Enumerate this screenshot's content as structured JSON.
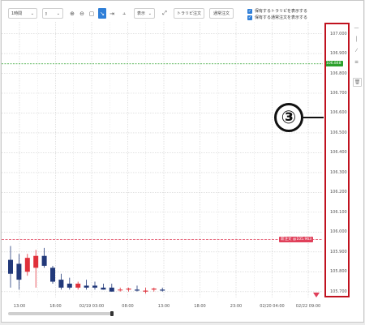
{
  "toolbar": {
    "timeframe": "1時間",
    "chart_type_icon": "candlestick-icon",
    "display_label": "表示",
    "trailing_order_button": "トラリピ注文",
    "normal_order_button": "通常注文",
    "check_trailing": "保有するトラリピを表示する",
    "check_normal": "保有する通常注文を表示する"
  },
  "chart_data": {
    "type": "candlestick",
    "price_labels": [
      "107.000",
      "106.900",
      "106.800",
      "106.700",
      "106.600",
      "106.500",
      "106.400",
      "106.300",
      "106.200",
      "106.100",
      "106.000",
      "105.900",
      "105.800",
      "105.700"
    ],
    "time_labels": [
      "13:00",
      "18:00",
      "02/19 03:00",
      "08:00",
      "13:00",
      "18:00",
      "23:00",
      "02/20 04:00",
      "02/22 09:00"
    ],
    "current_price": "106.848",
    "order_line_label": "新注文 @105.963",
    "current_price_color": "#2aa02a",
    "order_line_color": "#e0405a",
    "up_color": "#e0303a",
    "down_color": "#22397a",
    "ylim": [
      105.695,
      107.035
    ],
    "candles": [
      {
        "o": 105.86,
        "h": 105.93,
        "l": 105.72,
        "c": 105.79
      },
      {
        "o": 105.84,
        "h": 105.89,
        "l": 105.71,
        "c": 105.76
      },
      {
        "o": 105.8,
        "h": 105.89,
        "l": 105.78,
        "c": 105.87
      },
      {
        "o": 105.82,
        "h": 105.91,
        "l": 105.72,
        "c": 105.88
      },
      {
        "o": 105.88,
        "h": 105.92,
        "l": 105.82,
        "c": 105.83
      },
      {
        "o": 105.82,
        "h": 105.83,
        "l": 105.74,
        "c": 105.75
      },
      {
        "o": 105.76,
        "h": 105.79,
        "l": 105.71,
        "c": 105.72
      },
      {
        "o": 105.74,
        "h": 105.77,
        "l": 105.71,
        "c": 105.72
      },
      {
        "o": 105.72,
        "h": 105.75,
        "l": 105.71,
        "c": 105.74
      },
      {
        "o": 105.73,
        "h": 105.76,
        "l": 105.71,
        "c": 105.72
      },
      {
        "o": 105.73,
        "h": 105.75,
        "l": 105.71,
        "c": 105.72
      },
      {
        "o": 105.72,
        "h": 105.74,
        "l": 105.71,
        "c": 105.71
      },
      {
        "o": 105.72,
        "h": 105.74,
        "l": 105.7,
        "c": 105.7
      },
      {
        "o": 105.71,
        "h": 105.72,
        "l": 105.7,
        "c": 105.71
      },
      {
        "o": 105.71,
        "h": 105.72,
        "l": 105.7,
        "c": 105.715
      },
      {
        "o": 105.71,
        "h": 105.73,
        "l": 105.7,
        "c": 105.705
      },
      {
        "o": 105.7,
        "h": 105.72,
        "l": 105.69,
        "c": 105.705
      },
      {
        "o": 105.71,
        "h": 105.72,
        "l": 105.7,
        "c": 105.715
      },
      {
        "o": 105.71,
        "h": 105.72,
        "l": 105.7,
        "c": 105.705
      }
    ]
  },
  "annotation": {
    "number": "③"
  },
  "right_tools": [
    "minus-icon",
    "vertical-line-icon",
    "trend-line-icon",
    "text-icon",
    "trash-icon"
  ]
}
